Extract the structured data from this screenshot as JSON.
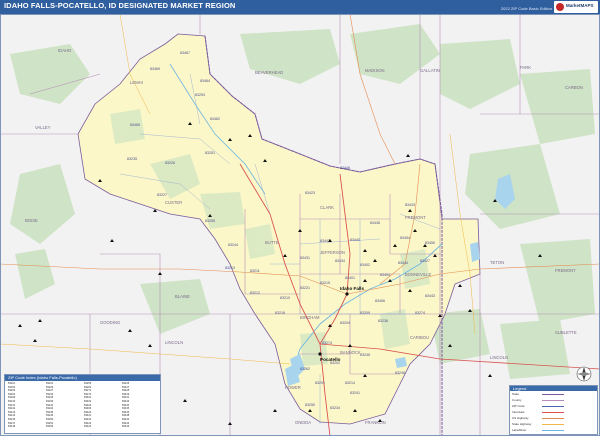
{
  "header": {
    "title": "IDAHO FALLS-POCATELLO, ID DESIGNATED MARKET REGION",
    "subtitle": "2022 ZIP Code Basic Edition",
    "logo_text": "MarketMAPS"
  },
  "colors": {
    "header_bg": "#2f5f9f",
    "region_fill": "#fbf7c8",
    "outside_fill": "#f2f2f2",
    "forest": "#cfe3c6",
    "water": "#a9d4ee",
    "county_line": "#b58fb8",
    "road": "#d9534f"
  },
  "counties": {
    "idaho": "IDAHO",
    "lemhi": "LEMHI",
    "beaverhead": "BEAVERHEAD",
    "madison": "MADISON",
    "gallatin": "GALLATIN",
    "valley": "VALLEY",
    "boise": "BOISE",
    "custer": "CUSTER",
    "butte": "BUTTE",
    "clark": "CLARK",
    "fremont": "FREMONT",
    "jefferson": "JEFFERSON",
    "bonneville": "BONNEVILLE",
    "bingham": "BINGHAM",
    "blaine": "BLAINE",
    "gooding": "GOODING",
    "lincoln": "LINCOLN",
    "power": "POWER",
    "bannock": "BANNOCK",
    "caribou": "CARIBOU",
    "oneida": "ONEIDA",
    "franklin": "FRANKLIN",
    "park": "PARK",
    "teton": "TETON",
    "lincoln_wy": "LINCOLN",
    "fremont_wy": "FREMONT",
    "sublette": "SUBLETTE",
    "carbon": "CARBON"
  },
  "cities": {
    "idaho_falls": "Idaho Falls",
    "pocatello": "Pocatello"
  },
  "zips": [
    "83467",
    "83469",
    "83464",
    "83465",
    "83253",
    "83462",
    "83226",
    "83251",
    "83255",
    "83235",
    "83227",
    "83423",
    "83446",
    "83433",
    "83436",
    "83440",
    "83442",
    "83401",
    "83402",
    "83404",
    "83406",
    "83427",
    "83434",
    "83431",
    "83443",
    "83444",
    "83450",
    "83454",
    "83221",
    "83215",
    "83262",
    "83274",
    "83202",
    "83201",
    "83204",
    "83209",
    "83245",
    "83214",
    "83246",
    "83241",
    "83234",
    "83250",
    "83212",
    "83211",
    "83213",
    "83244",
    "83236",
    "83274",
    "83218",
    "83210"
  ],
  "legend": {
    "heading": "ZIP Code Index (Idaho Falls-Pocatello)",
    "col1": [
      "83201",
      "83202",
      "83203",
      "83204",
      "83209",
      "83210",
      "83211",
      "83212",
      "83213",
      "83214",
      "83215",
      "83217",
      "83218"
    ],
    "col2": [
      "83221",
      "83226",
      "83227",
      "83234",
      "83235",
      "83236",
      "83241",
      "83244",
      "83245",
      "83246",
      "83250",
      "83251",
      "83253"
    ],
    "col3": [
      "83255",
      "83262",
      "83271",
      "83274",
      "83401",
      "83402",
      "83404",
      "83406",
      "83420",
      "83421",
      "83422",
      "83423",
      "83424"
    ],
    "col4": [
      "83425",
      "83427",
      "83428",
      "83429",
      "83431",
      "83433",
      "83434",
      "83435",
      "83436",
      "83438",
      "83440",
      "83442",
      "83443"
    ]
  },
  "key": {
    "heading": "Legend",
    "items": [
      {
        "label": "State",
        "color": "#7a5a9a"
      },
      {
        "label": "County",
        "color": "#b58fb8"
      },
      {
        "label": "ZIP Code",
        "color": "#4a6ab0"
      },
      {
        "label": "Interstate",
        "color": "#d9534f"
      },
      {
        "label": "US Highway",
        "color": "#e58a4f"
      },
      {
        "label": "State Highway",
        "color": "#f0b84a"
      },
      {
        "label": "Lake/River",
        "color": "#6fb6e0"
      }
    ]
  }
}
